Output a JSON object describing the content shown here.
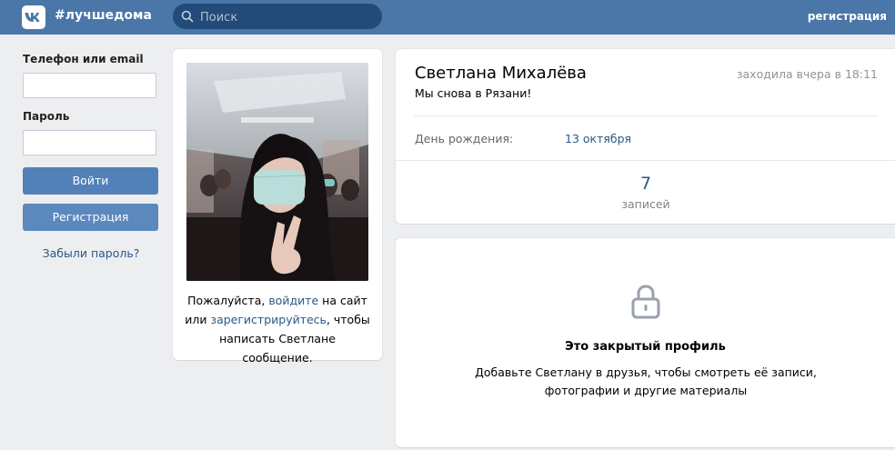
{
  "header": {
    "logo_icon": "vk-logo-icon",
    "hashtag": "#лучшедома",
    "search_placeholder": "Поиск",
    "register_link": "регистрация",
    "bg_color": "#4a76a8"
  },
  "login": {
    "phone_label": "Телефон или email",
    "phone_value": "",
    "password_label": "Пароль",
    "password_value": "",
    "login_button": "Войти",
    "register_button": "Регистрация",
    "forgot_link": "Забыли пароль?"
  },
  "photo_card": {
    "text_prefix": "Пожалуйста, ",
    "login_link": "войдите",
    "text_middle": " на сайт или ",
    "register_link": "зарегистрируйтесь",
    "text_suffix": ", чтобы написать Светлане сообщение."
  },
  "profile": {
    "name": "Светлана Михалёва",
    "last_seen": "заходила вчера в 18:11",
    "status": "Мы снова в Рязани!",
    "birthday_label": "День рождения:",
    "birthday_value": "13 октября",
    "posts_count": "7",
    "posts_label": "записей"
  },
  "closed": {
    "lock_icon": "lock-icon",
    "title": "Это закрытый профиль",
    "text": "Добавьте Светлану в друзья, чтобы смотреть её записи, фотографии и другие материалы"
  },
  "colors": {
    "link": "#2a5885",
    "button": "#5181b8",
    "page_bg": "#edeef0"
  }
}
